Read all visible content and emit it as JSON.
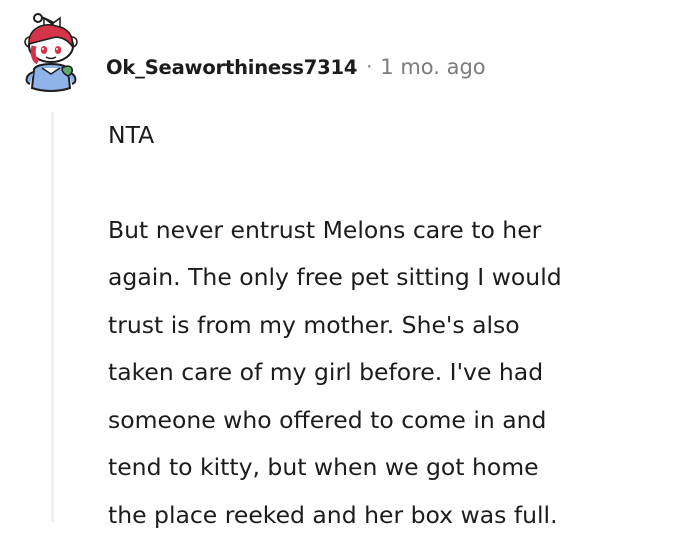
{
  "comment": {
    "author": "Ok_Seaworthiness7314",
    "separator": "·",
    "timestamp": "1 mo. ago",
    "paragraphs": [
      [
        "NTA"
      ],
      [
        "But never entrust Melons care to her",
        "again. The only free pet sitting I would",
        "trust is from my mother. She's also",
        "taken care of my girl before. I've had",
        "someone who offered to come in and",
        "tend to kitty, but when we got home",
        "the place reeked and her box was full."
      ]
    ]
  },
  "colors": {
    "text": "#1c1c1c",
    "meta": "#7c7c7c",
    "thread_line": "#edeff1",
    "avatar_hair": "#d4334a",
    "avatar_body": "#8fb2e8"
  },
  "icons": {
    "avatar": "snoo-avatar-icon"
  }
}
